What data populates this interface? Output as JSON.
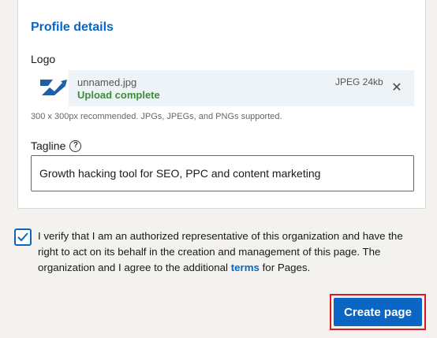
{
  "profile": {
    "section_title": "Profile details",
    "logo_label": "Logo",
    "file": {
      "name": "unnamed.jpg",
      "status": "Upload complete",
      "meta": "JPEG 24kb",
      "remove_glyph": "✕"
    },
    "hint": "300 x 300px recommended. JPGs, JPEGs, and PNGs supported.",
    "tagline_label": "Tagline",
    "tagline_help_glyph": "?",
    "tagline_value": "Growth hacking tool for SEO, PPC and content marketing"
  },
  "verify": {
    "checked": true,
    "text_before": "I verify that I am an authorized representative of this organization and have the right to act on its behalf in the creation and management of this page. The organization and I agree to the additional ",
    "link": "terms",
    "text_after": " for Pages."
  },
  "actions": {
    "create_label": "Create page"
  },
  "colors": {
    "accent": "#0a66c2",
    "success": "#3d8c3a",
    "highlight": "#e0151f"
  },
  "icons": {
    "logo_thumb": "company-logo-icon",
    "remove": "close-icon",
    "help": "help-icon",
    "check": "checkmark-icon"
  }
}
